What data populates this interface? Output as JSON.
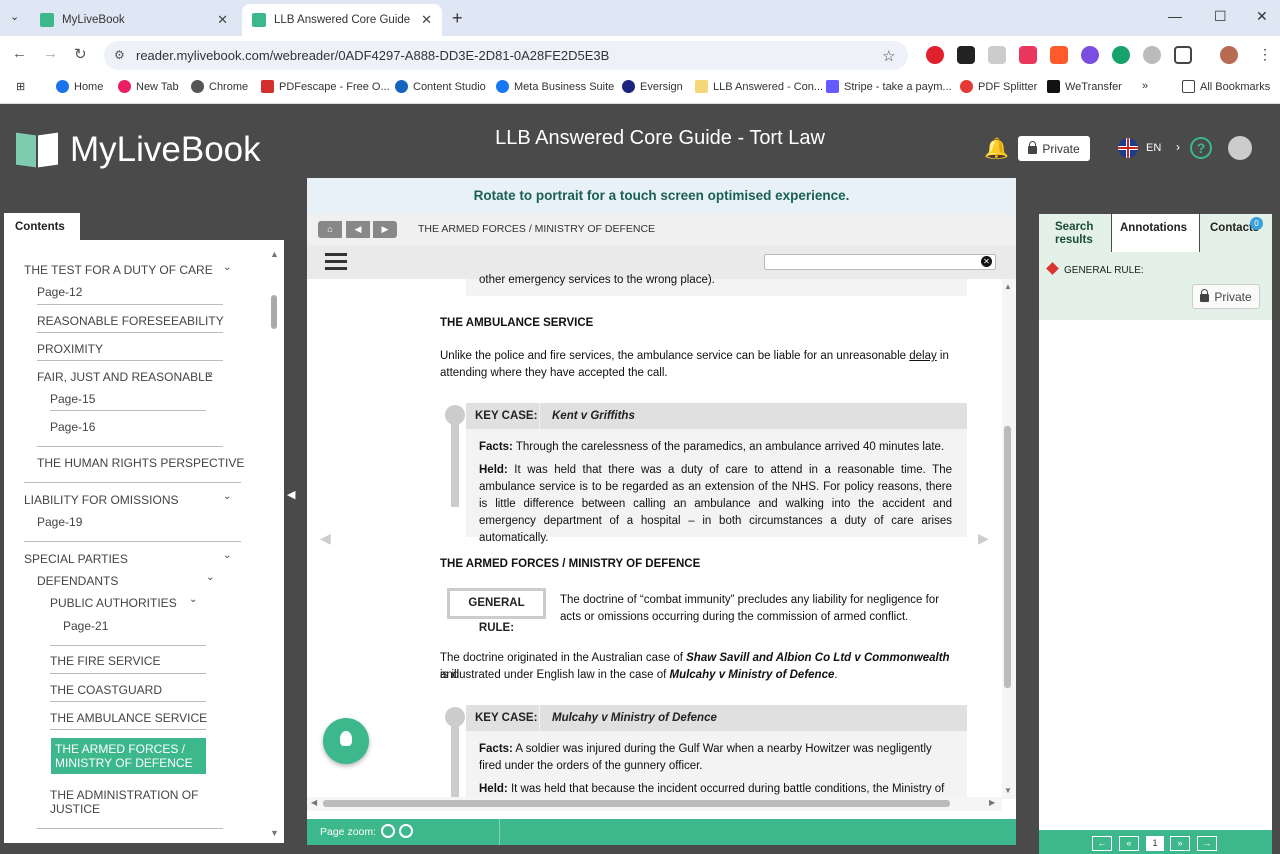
{
  "browser": {
    "tabs": [
      {
        "title": "MyLiveBook"
      },
      {
        "title": "LLB Answered Core Guide - Tort"
      }
    ],
    "url": "reader.mylivebook.com/webreader/0ADF4297-A888-DD3E-2D81-0A28FE2D5E3B",
    "bookmarks": [
      "Home",
      "New Tab",
      "Chrome",
      "PDFescape - Free O...",
      "Content Studio",
      "Meta Business Suite",
      "Eversign",
      "LLB Answered - Con...",
      "Stripe - take a paym...",
      "PDF Splitter",
      "WeTransfer",
      "All Bookmarks"
    ],
    "more": "»"
  },
  "app": {
    "logo": "MyLiveBook",
    "title": "LLB Answered Core Guide - Tort Law",
    "private_label": "Private",
    "lang": "EN",
    "help": "?"
  },
  "contents": {
    "tab_label": "Contents",
    "items": [
      "THE TEST FOR A DUTY OF CARE",
      "Page-12",
      "REASONABLE FORESEEABILITY",
      "PROXIMITY",
      "FAIR, JUST AND REASONABLE",
      "Page-15",
      "Page-16",
      "THE HUMAN RIGHTS PERSPECTIVE",
      "LIABILITY FOR OMISSIONS",
      "Page-19",
      "SPECIAL PARTIES",
      "DEFENDANTS",
      "PUBLIC AUTHORITIES",
      "Page-21",
      "THE FIRE SERVICE",
      "THE COASTGUARD",
      "THE AMBULANCE SERVICE",
      "THE ARMED FORCES / MINISTRY OF DEFENCE",
      "THE ADMINISTRATION OF JUSTICE"
    ]
  },
  "reader": {
    "banner": "Rotate to portrait for a touch screen optimised experience.",
    "breadcrumb": "THE ARMED FORCES / MINISTRY OF DEFENCE",
    "zoom_label": "Page zoom:",
    "doc": {
      "top_fragment": "other emergency services to the wrong place).",
      "h1": "THE AMBULANCE SERVICE",
      "p1_a": "Unlike the police and fire services, the ambulance service can be liable for an unreasonable",
      "p1_link": "delay",
      "p1_b": " in",
      "p1_c": "attending where they have accepted the call.",
      "kc1_label": "KEY CASE:",
      "kc1_name": "Kent v Griffiths",
      "kc1_facts_label": "Facts:",
      "kc1_facts": " Through the carelessness of the paramedics, an ambulance arrived 40 minutes late.",
      "kc1_held_label": "Held:",
      "kc1_held": " It was held that there was a duty of care to attend in a reasonable time. The ambulance service is to be regarded as an extension of the NHS. For policy reasons, there is little difference between calling an ambulance and walking into the accident and emergency department of a hospital – in both circumstances a duty of care arises automatically.",
      "h2": "THE ARMED FORCES / MINISTRY OF DEFENCE",
      "gr_label": "GENERAL RULE:",
      "gr_text": "The doctrine of “combat immunity” precludes any liability for negligence for acts or omissions occurring during the commission of armed conflict.",
      "p2_a": "The doctrine originated in the Australian case of ",
      "p2_case1": "Shaw Savill and Albion Co Ltd v Commonwealth",
      "p2_b": " and",
      "p2_c": "is illustrated under English law in the case of ",
      "p2_case2": "Mulcahy v Ministry of Defence",
      "p2_d": ".",
      "kc2_label": "KEY CASE:",
      "kc2_name": "Mulcahy v Ministry of Defence",
      "kc2_facts_label": "Facts:",
      "kc2_facts": " A soldier was injured during the Gulf War when a nearby Howitzer was negligently fired under the orders of the gunnery officer.",
      "kc2_held_label": "Held:",
      "kc2_held": " It was held that because the incident occurred during battle conditions, the Ministry of"
    }
  },
  "right": {
    "tabs": [
      "Search results",
      "Annotations",
      "Contacts"
    ],
    "badge": "0",
    "annotation": "GENERAL RULE:",
    "private_label": "Private",
    "pager": {
      "first": "←",
      "prev": "«",
      "page": "1",
      "next": "»",
      "last": "→"
    }
  },
  "colors": {
    "accent": "#3cb88c",
    "header": "#4a4a4a",
    "selected": "#3cb88c"
  }
}
